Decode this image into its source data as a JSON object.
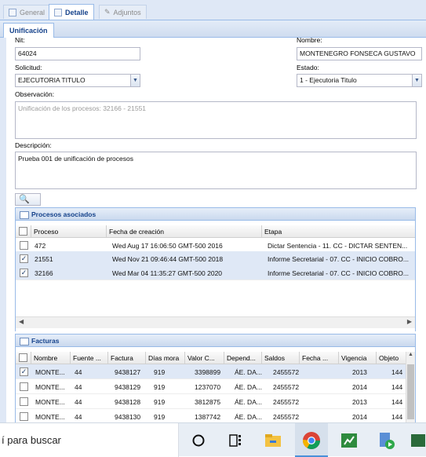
{
  "top_tabs": [
    {
      "label": "General",
      "icon": "document-icon"
    },
    {
      "label": "Detalle",
      "icon": "grid-icon"
    },
    {
      "label": "Adjuntos",
      "icon": "paperclip-icon"
    }
  ],
  "sub_tab": "Unificación",
  "form": {
    "nit_label": "Nit:",
    "nit_value": "64024",
    "nombre_label": "Nombre:",
    "nombre_value": "MONTENEGRO FONSECA GUSTAVO",
    "solicitud_label": "Solicitud:",
    "solicitud_value": "EJECUTORIA TITULO",
    "estado_label": "Estado:",
    "estado_value": "1 - Ejecutoria Titulo",
    "observacion_label": "Observación:",
    "observacion_value": "Unificación de los procesos: 32166 - 21551",
    "descripcion_label": "Descripción:",
    "descripcion_value": "Prueba 001 de unificación de procesos"
  },
  "procesos": {
    "title": "Procesos asociados",
    "columns": [
      "Proceso",
      "Fecha de creación",
      "Etapa"
    ],
    "rows": [
      {
        "checked": false,
        "proceso": "472",
        "fecha": "Wed Aug 17 16:06:50 GMT-500 2016",
        "etapa": "Dictar Sentencia - 11. CC - DICTAR SENTEN..."
      },
      {
        "checked": true,
        "proceso": "21551",
        "fecha": "Wed Nov 21 09:46:44 GMT-500 2018",
        "etapa": "Informe Secretarial - 07. CC - INICIO COBRO..."
      },
      {
        "checked": true,
        "proceso": "32166",
        "fecha": "Wed Mar 04 11:35:27 GMT-500 2020",
        "etapa": "Informe Secretarial - 07. CC - INICIO COBRO..."
      }
    ]
  },
  "facturas": {
    "title": "Facturas",
    "columns": [
      "Nombre",
      "Fuente ...",
      "Factura",
      "Días mora",
      "Valor C...",
      "Depend...",
      "Saldos",
      "Fecha ...",
      "Vigencia",
      "Objeto"
    ],
    "rows": [
      {
        "checked": true,
        "cells": [
          "MONTE...",
          "44",
          "9438127",
          "919",
          "3398899",
          "ÁE. DA...",
          "2455572",
          "",
          "2013",
          "144"
        ]
      },
      {
        "checked": false,
        "cells": [
          "MONTE...",
          "44",
          "9438129",
          "919",
          "1237070",
          "ÁE. DA...",
          "2455572",
          "",
          "2014",
          "144"
        ]
      },
      {
        "checked": false,
        "cells": [
          "MONTE...",
          "44",
          "9438128",
          "919",
          "3812875",
          "ÁE. DA...",
          "2455572",
          "",
          "2013",
          "144"
        ]
      },
      {
        "checked": false,
        "cells": [
          "MONTE...",
          "44",
          "9438130",
          "919",
          "1387742",
          "ÁE. DA...",
          "2455572",
          "",
          "2014",
          "144"
        ]
      }
    ]
  },
  "taskbar": {
    "search_text": "í para buscar",
    "apps": [
      "cortana-circle-icon",
      "task-view-icon",
      "file-explorer-icon",
      "chrome-icon",
      "spreadsheet-app-icon",
      "media-app-icon",
      "app-icon"
    ]
  },
  "colors": {
    "header_blue": "#15428b",
    "panel_border": "#99bbe8",
    "selected_row": "#dfe8f6"
  }
}
